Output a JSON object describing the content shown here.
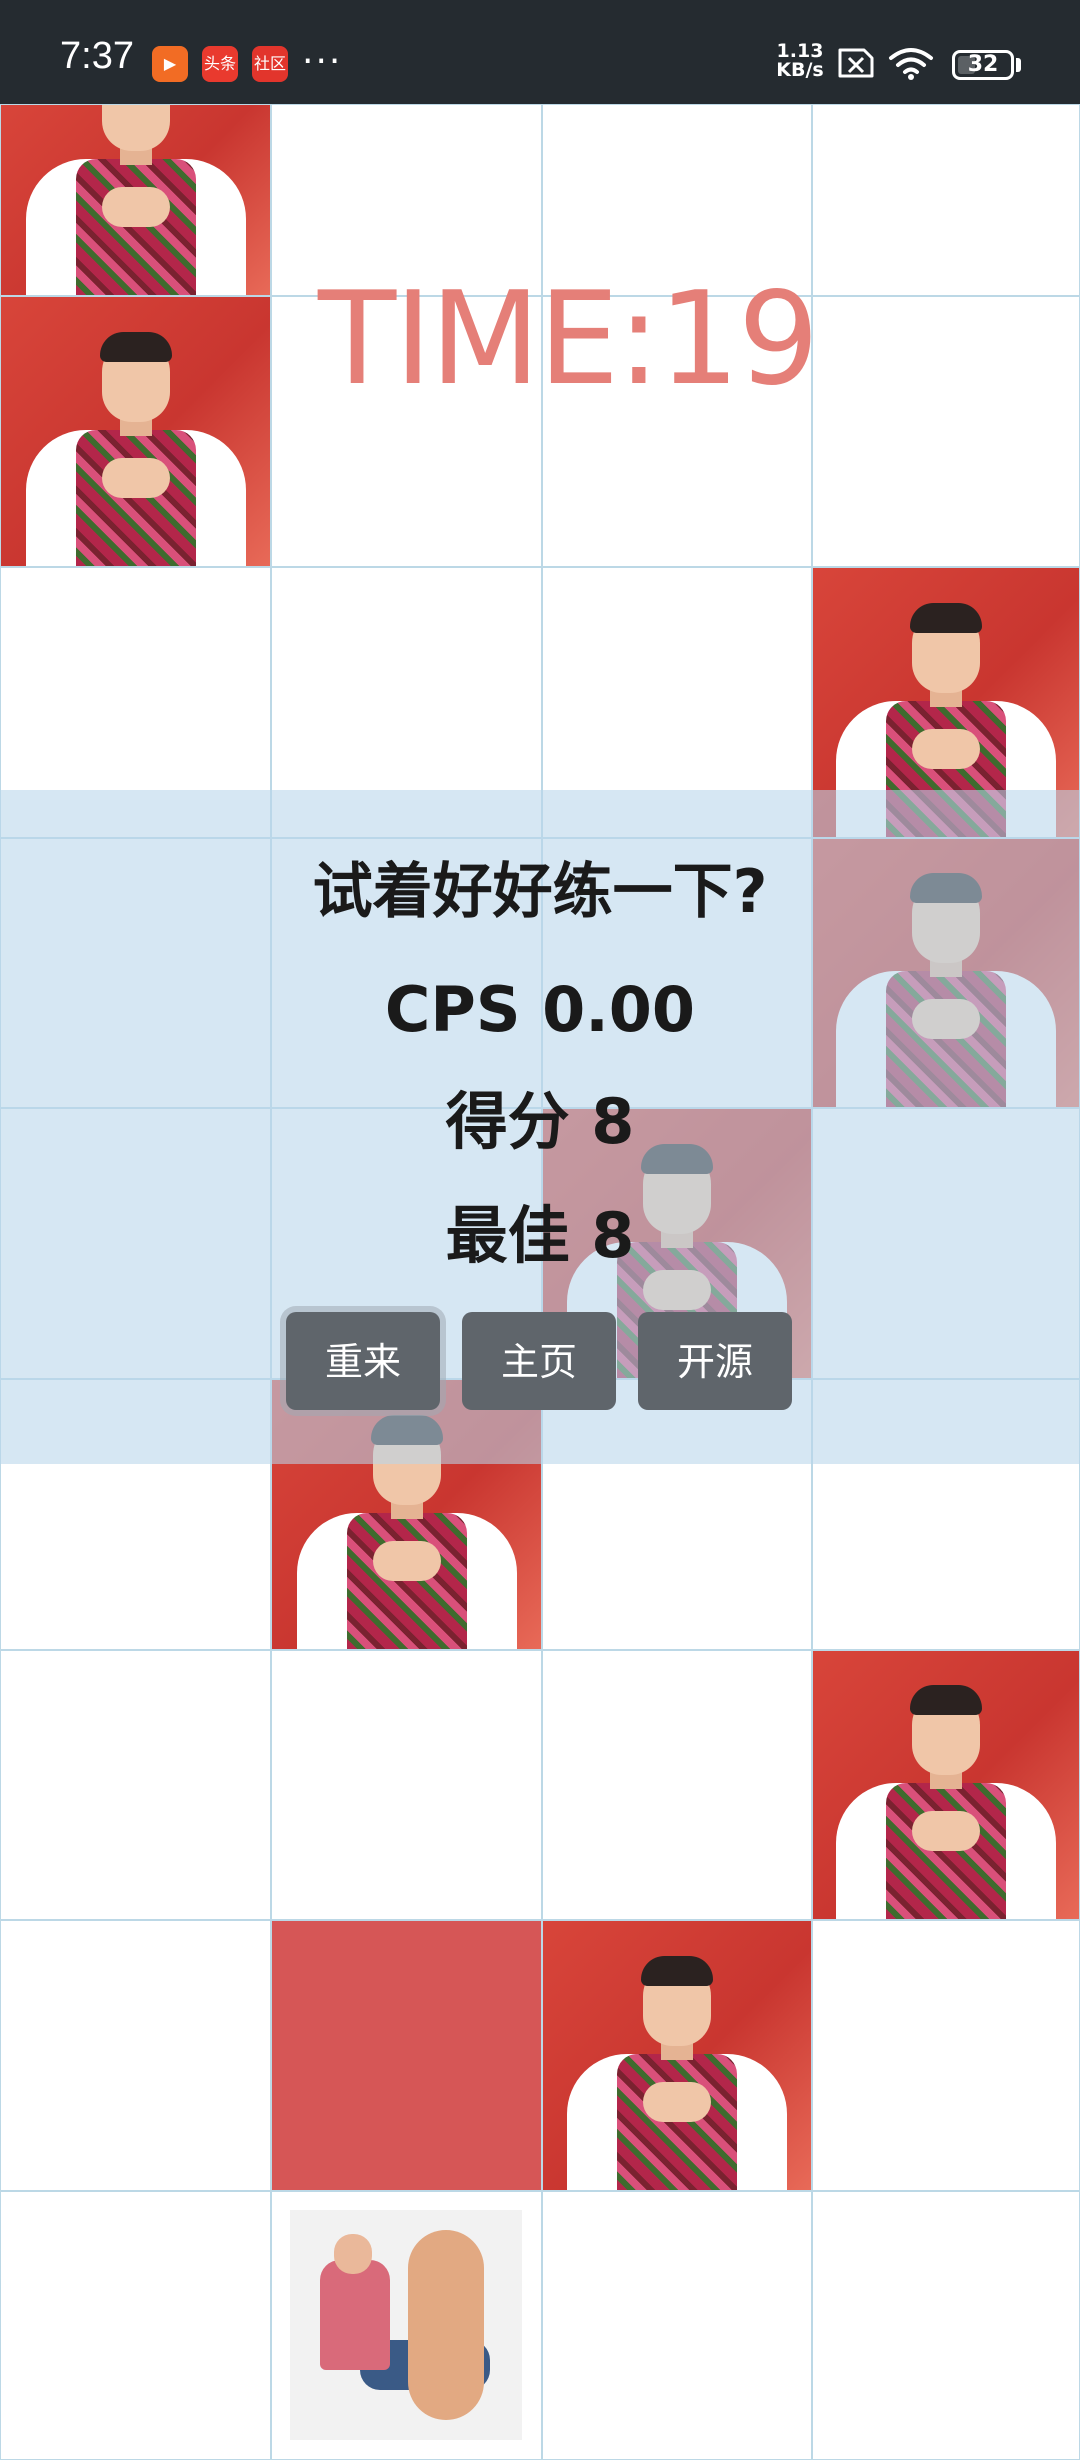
{
  "status_bar": {
    "time": "7:37",
    "apps": [
      "video-app-icon",
      "toutiao-app-icon",
      "community-app-icon"
    ],
    "app_labels": [
      "▶",
      "头条",
      "社区"
    ],
    "more": "···",
    "net_speed_value": "1.13",
    "net_speed_unit": "KB/s",
    "battery": "32"
  },
  "game": {
    "timer": "TIME:19",
    "hint": "试着好好练一下?",
    "cps": "CPS 0.00",
    "score": "得分 8",
    "best": "最佳 8",
    "buttons": {
      "restart": "重来",
      "home": "主页",
      "source": "开源"
    }
  },
  "board": {
    "columns": 4,
    "rows_visible": 9,
    "tiles": [
      {
        "row": 0,
        "col": 0,
        "type": "photo"
      },
      {
        "row": 1,
        "col": 0,
        "type": "photo"
      },
      {
        "row": 2,
        "col": 3,
        "type": "photo"
      },
      {
        "row": 3,
        "col": 3,
        "type": "photo"
      },
      {
        "row": 4,
        "col": 2,
        "type": "photo"
      },
      {
        "row": 5,
        "col": 1,
        "type": "photo"
      },
      {
        "row": 6,
        "col": 3,
        "type": "photo"
      },
      {
        "row": 7,
        "col": 1,
        "type": "missed-red"
      },
      {
        "row": 7,
        "col": 2,
        "type": "photo"
      },
      {
        "row": 8,
        "col": 1,
        "type": "feet-photo"
      }
    ]
  },
  "colors": {
    "status_bar_bg": "#252b30",
    "timer_text": "#e57f78",
    "overlay_bg": "#b8d6ea",
    "button_bg": "#5f656b",
    "missed_tile": "#d65656",
    "grid_line": "#bcd8e6"
  }
}
